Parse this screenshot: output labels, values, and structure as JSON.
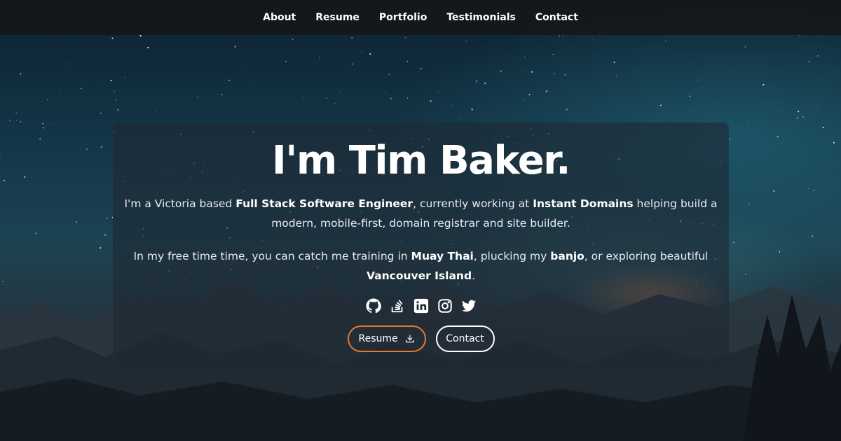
{
  "nav": {
    "items": [
      {
        "label": "About"
      },
      {
        "label": "Resume"
      },
      {
        "label": "Portfolio"
      },
      {
        "label": "Testimonials"
      },
      {
        "label": "Contact"
      }
    ]
  },
  "hero": {
    "title": "I'm Tim Baker.",
    "p1": {
      "t1": "I'm a Victoria based ",
      "b1": "Full Stack Software Engineer",
      "t2": ", currently working at ",
      "b2": "Instant Domains",
      "t3": " helping build a modern, mobile-first, domain registrar and site builder."
    },
    "p2": {
      "t1": "In my free time time, you can catch me training in ",
      "b1": "Muay Thai",
      "t2": ", plucking my ",
      "b2": "banjo",
      "t3": ", or exploring beautiful ",
      "b3": "Vancouver Island",
      "t4": "."
    },
    "socials": [
      "github-icon",
      "stackoverflow-icon",
      "linkedin-icon",
      "instagram-icon",
      "twitter-icon"
    ],
    "buttons": {
      "resume_label": "Resume",
      "contact_label": "Contact"
    }
  },
  "colors": {
    "navbar": "#16181b",
    "resume_border": "#e8782a",
    "contact_border": "#ffffff"
  }
}
